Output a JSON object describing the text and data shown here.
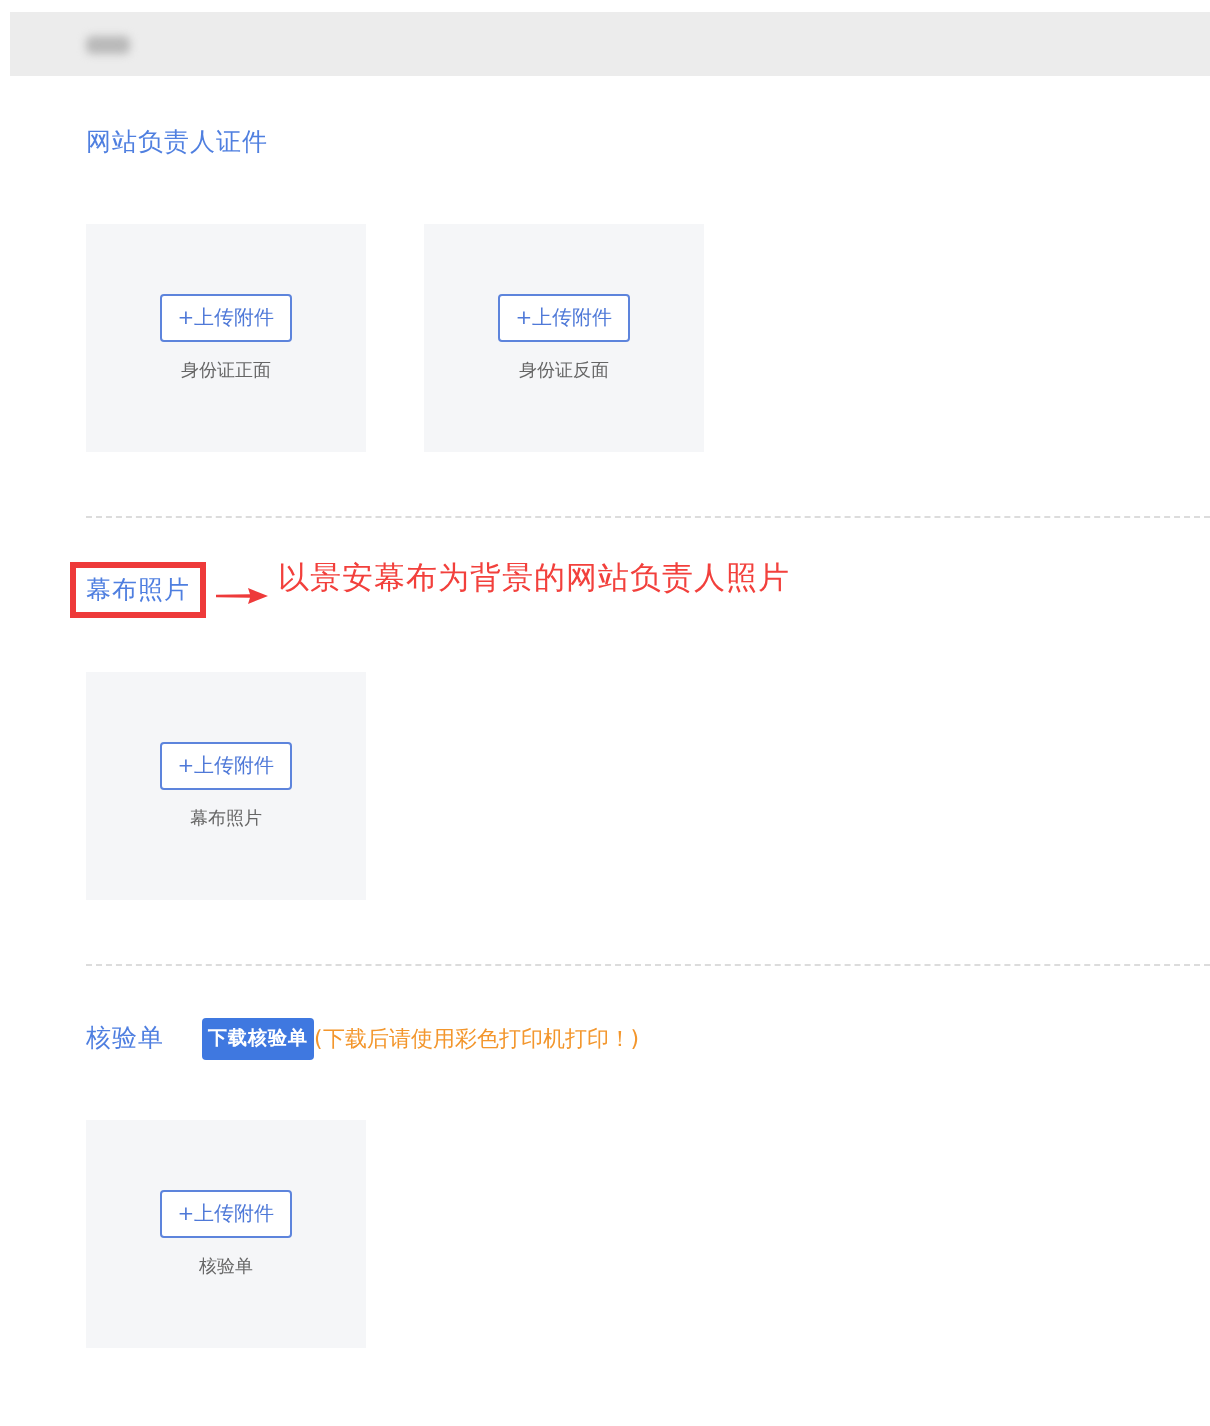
{
  "sections": [
    {
      "title": "网站负责人证件",
      "highlighted": false,
      "uploads": [
        {
          "button": "+上传附件",
          "caption": "身份证正面"
        },
        {
          "button": "+上传附件",
          "caption": "身份证反面"
        }
      ]
    },
    {
      "title": "幕布照片",
      "highlighted": true,
      "annotation": "以景安幕布为背景的网站负责人照片",
      "uploads": [
        {
          "button": "+上传附件",
          "caption": "幕布照片"
        }
      ]
    },
    {
      "title": "核验单",
      "highlighted": false,
      "download_button": "下载核验单",
      "note": "(下载后请使用彩色打印机打印！)",
      "uploads": [
        {
          "button": "+上传附件",
          "caption": "核验单"
        }
      ]
    }
  ]
}
